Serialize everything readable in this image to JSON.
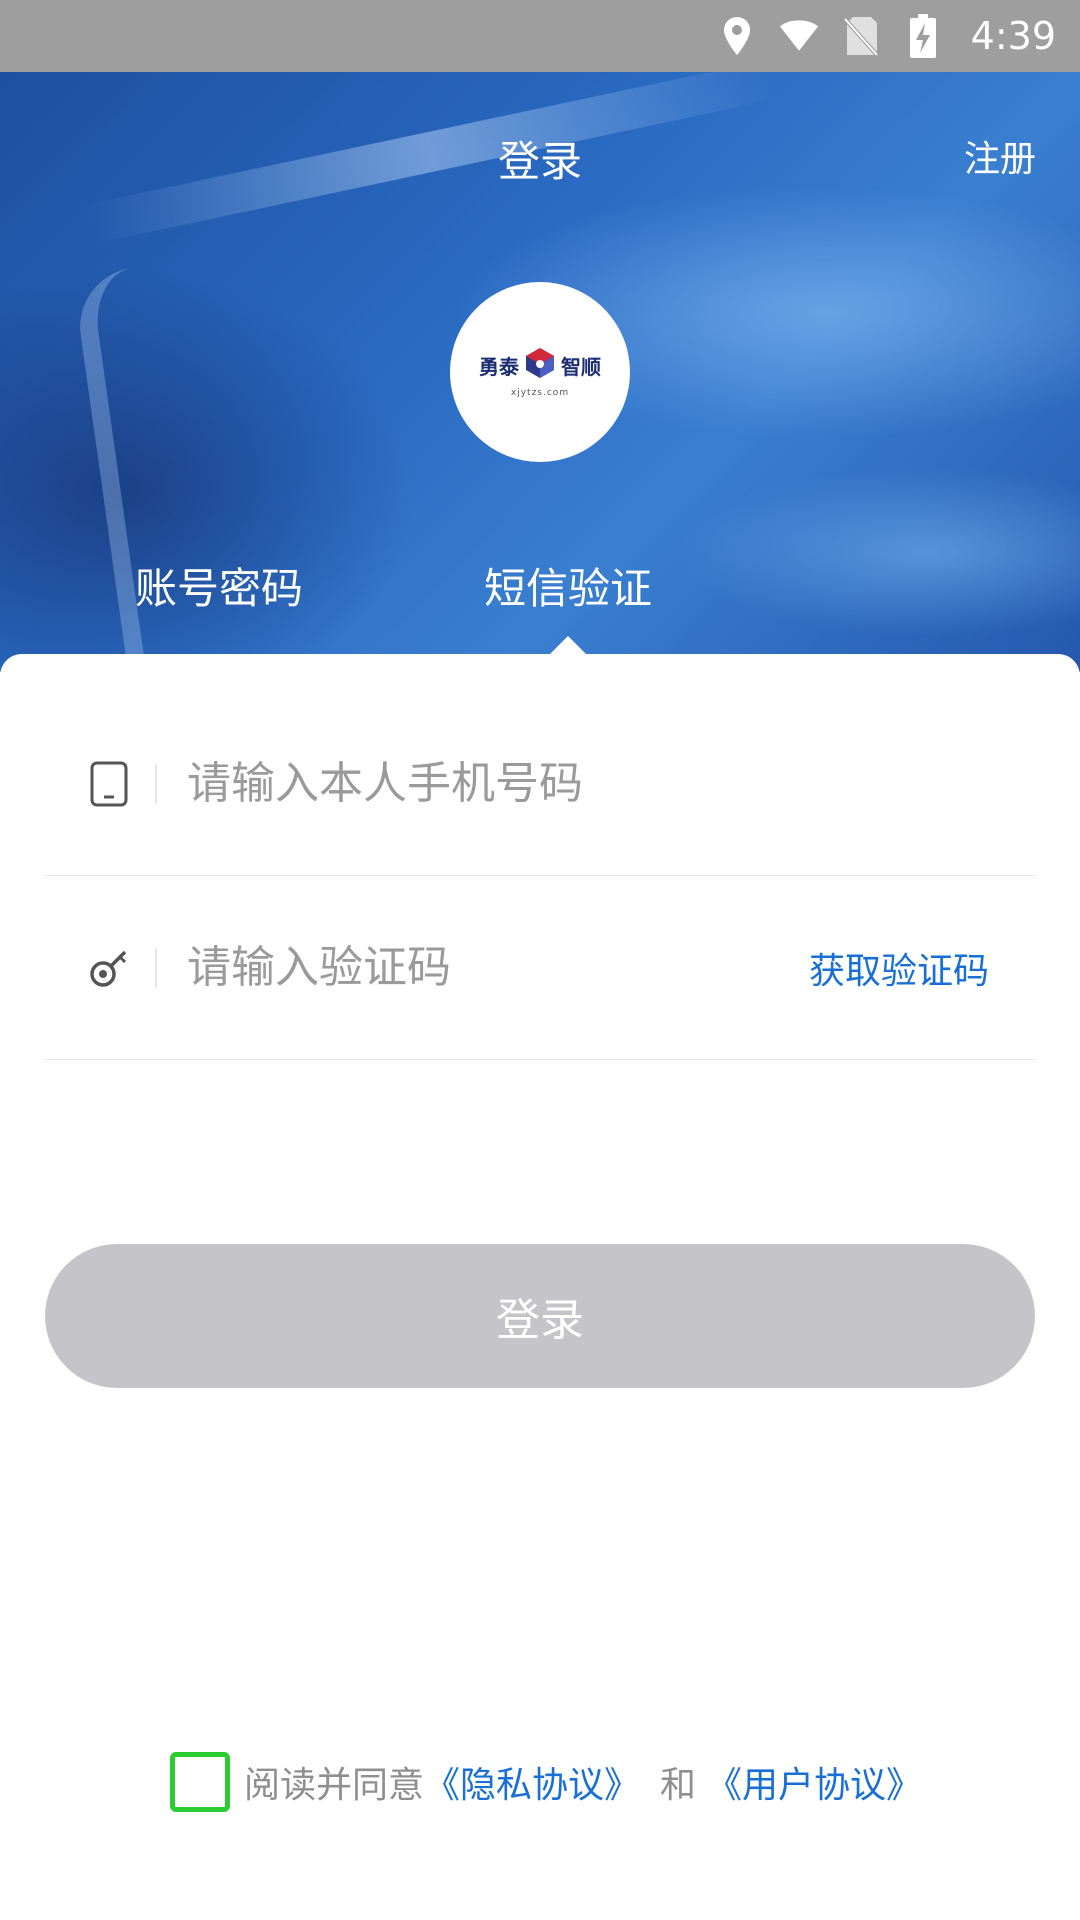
{
  "status_bar": {
    "time": "4:39"
  },
  "header": {
    "title": "登录",
    "register": "注册"
  },
  "logo": {
    "left_text": "勇泰",
    "right_text": "智顺",
    "sub_text": "xjytzs.com"
  },
  "tabs": [
    {
      "label": "账号密码",
      "active": false
    },
    {
      "label": "短信验证",
      "active": true
    }
  ],
  "form": {
    "phone_placeholder": "请输入本人手机号码",
    "code_placeholder": "请输入验证码",
    "get_code_label": "获取验证码"
  },
  "login_button": {
    "label": "登录"
  },
  "agreement": {
    "prefix": "阅读并同意",
    "privacy": "《隐私协议》",
    "and": "和",
    "user": "《用户协议》",
    "checked": false
  },
  "colors": {
    "link": "#1a6fd6",
    "checkbox_border": "#2ccd33",
    "button_disabled": "#c5c4c8",
    "status_bar": "#9e9e9e"
  }
}
